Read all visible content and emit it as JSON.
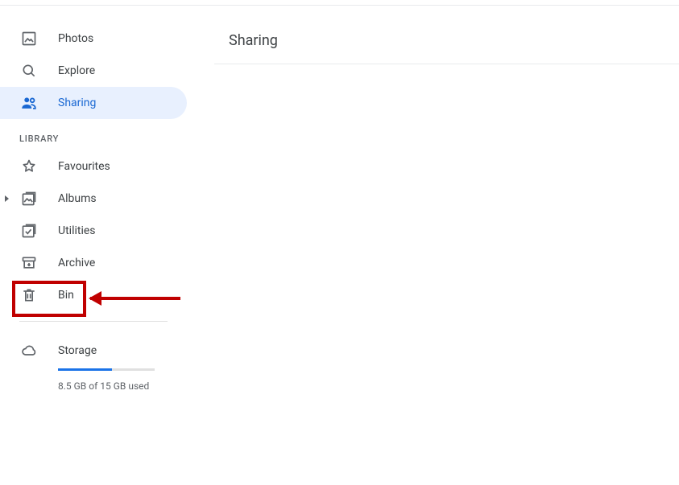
{
  "sidebar": {
    "nav": [
      {
        "label": "Photos"
      },
      {
        "label": "Explore"
      },
      {
        "label": "Sharing"
      }
    ],
    "library_header": "LIBRARY",
    "library": [
      {
        "label": "Favourites"
      },
      {
        "label": "Albums"
      },
      {
        "label": "Utilities"
      },
      {
        "label": "Archive"
      },
      {
        "label": "Bin"
      }
    ],
    "storage": {
      "label": "Storage",
      "usage_text": "8.5 GB of 15 GB used",
      "used_gb": 8.5,
      "total_gb": 15
    }
  },
  "main": {
    "title": "Sharing"
  }
}
